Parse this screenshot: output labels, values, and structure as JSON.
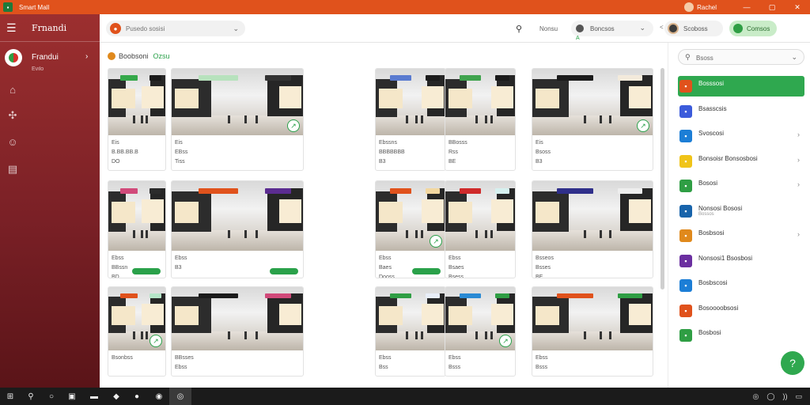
{
  "window": {
    "title": "Smart Mall",
    "user_name": "Rachel"
  },
  "sidebar": {
    "brand": "Frnandi",
    "profile_name": "Frandui",
    "profile_sub": "Evilo",
    "icons": [
      "store-icon",
      "puzzle-icon",
      "user-icon",
      "document-icon"
    ]
  },
  "header": {
    "search_placeholder": "Pusedo sosisi",
    "link_text": "Nonsu",
    "user_label": "Boncsos",
    "user_under": "A",
    "separator": "<",
    "account_label": "Scoboss",
    "action_button": "Comsos"
  },
  "main": {
    "section_title": "Boobsoni",
    "section_tag": "Ozsu",
    "cards": [
      {
        "line1": "Eis",
        "line2": "B.BB.BB.B",
        "line3": "DO",
        "signs": [
          "#35a84a",
          "#1b1b1b"
        ]
      },
      {
        "line1": "Eis",
        "line2": "EBss",
        "line3": "Tiss",
        "signs": [
          "#b7e2bd",
          "#333333"
        ]
      },
      {
        "line1": "Ebssns",
        "line2": "BBBBBBB",
        "line3": "B3",
        "signs": [
          "#5a7bd0",
          "#1b1b1b"
        ]
      },
      {
        "line1": "BBosss",
        "line2": "Rss",
        "line3": "BE",
        "signs": [
          "#3fa34d",
          "#1b1b1b"
        ]
      },
      {
        "line1": "Eis",
        "line2": "Bsoss",
        "line3": "B3",
        "signs": [
          "#1b1b1b",
          "#f3eadb"
        ]
      },
      {
        "line1": "Ebss",
        "line2": "BBssn",
        "line3": "BD",
        "signs": [
          "#d14a7a",
          "#2b2b2b"
        ]
      },
      {
        "line1": "Ebss",
        "line2": "B3",
        "line3": "",
        "signs": [
          "#e0521c",
          "#5b2c91"
        ]
      },
      {
        "line1": "Ebss",
        "line2": "Baes",
        "line3": "Dooss",
        "signs": [
          "#e0521c",
          "#f2d7a0"
        ]
      },
      {
        "line1": "Ebss",
        "line2": "Bsaes",
        "line3": "Bsess",
        "signs": [
          "#cf2a2a",
          "#d6f0ef"
        ]
      },
      {
        "line1": "Bsseos",
        "line2": "Bsses",
        "line3": "BE",
        "signs": [
          "#2f2f8a",
          "#eeeeee"
        ]
      },
      {
        "line1": "Bsonbss",
        "line2": "",
        "line3": "",
        "signs": [
          "#e0521c",
          "#b5e5c8"
        ]
      },
      {
        "line1": "BBsses",
        "line2": "Ebss",
        "line3": "",
        "signs": [
          "#1b1b1b",
          "#d14a7a"
        ]
      },
      {
        "line1": "Ebss",
        "line2": "Bss",
        "line3": "",
        "signs": [
          "#2f9e44",
          "#e8eef8"
        ]
      },
      {
        "line1": "Ebss",
        "line2": "Bsss",
        "line3": "",
        "signs": [
          "#2a8ad4",
          "#2f9e44"
        ]
      },
      {
        "line1": "Ebss",
        "line2": "Bsss",
        "line3": "",
        "signs": [
          "#e0521c",
          "#2f9e44"
        ]
      }
    ]
  },
  "right_panel": {
    "search_text": "Bsoss",
    "items": [
      {
        "label": "Bosssosi",
        "sub": "",
        "icon_color": "#e0521c",
        "active": true
      },
      {
        "label": "Bsasscsis",
        "sub": "",
        "icon_color": "#3b5bdb",
        "active": false
      },
      {
        "label": "Svoscosi",
        "sub": "",
        "icon_color": "#1c7ed6",
        "active": false
      },
      {
        "label": "Bonsoisr Bonsosbosi",
        "sub": "",
        "icon_color": "#f0c419",
        "active": false
      },
      {
        "label": "Bososi",
        "sub": "",
        "icon_color": "#2f9e44",
        "active": false
      },
      {
        "label": "Nonsosi Bososi",
        "sub": "Bossos",
        "icon_color": "#1864ab",
        "active": false
      },
      {
        "label": "Bosbsosi",
        "sub": "",
        "icon_color": "#e0891c",
        "active": false
      },
      {
        "label": "Nonsosi1 Bsosbosi",
        "sub": "",
        "icon_color": "#6b2fa0",
        "active": false
      },
      {
        "label": "Bosbscosi",
        "sub": "",
        "icon_color": "#1c7ed6",
        "active": false
      },
      {
        "label": "Bosoooobsosi",
        "sub": "",
        "icon_color": "#e0521c",
        "active": false
      },
      {
        "label": "Bosbosi",
        "sub": "",
        "icon_color": "#2f9e44",
        "active": false
      }
    ],
    "fab_label": "?"
  },
  "taskbar": {
    "icons": [
      "windows-icon",
      "search-icon",
      "circle-icon",
      "store-app-icon",
      "folder-icon",
      "shield-icon",
      "photo-icon",
      "edge-icon",
      "chrome-icon"
    ],
    "tray": [
      "◎",
      "◯",
      "))",
      "▭"
    ]
  }
}
